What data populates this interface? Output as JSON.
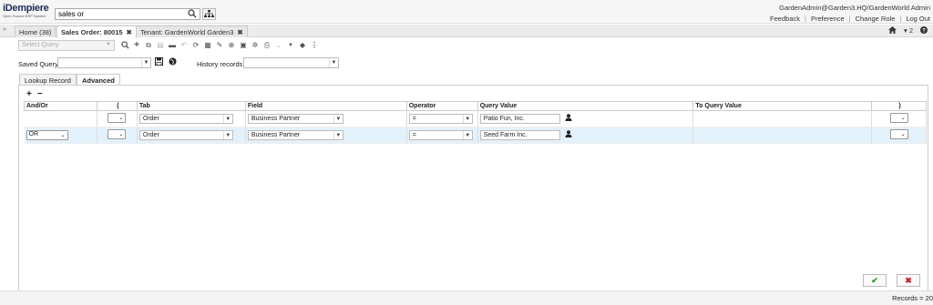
{
  "header": {
    "logo_text": "iDempiere",
    "logo_subtext": "Open Source ERP System",
    "search_value": "sales or",
    "user_info": "GardenAdmin@Garden3.HQ/GardenWorld Admin",
    "links": [
      "Feedback",
      "Preference",
      "Change Role",
      "Log Out"
    ]
  },
  "tabs": [
    {
      "label": "Home (38)",
      "active": false,
      "closable": false
    },
    {
      "label": "Sales Order: 80015",
      "active": true,
      "closable": true
    },
    {
      "label": "Tenant: GardenWorld Garden3",
      "active": false,
      "closable": true
    }
  ],
  "tab_right": {
    "home_icon": "home-icon",
    "count_label": "▾ 2",
    "help_icon": "help-icon"
  },
  "toolbar": {
    "select_query_placeholder": "Select Query",
    "icons": [
      "search-icon",
      "new-icon",
      "copy-icon",
      "delete-icon",
      "minus-icon",
      "undo-icon",
      "refresh-icon",
      "grid-toggle-icon",
      "attachment-icon",
      "zoom-icon",
      "report-icon",
      "settings-icon",
      "print-icon",
      "arrow-icon",
      "chevron-icon",
      "tag-icon",
      "more-icon"
    ]
  },
  "saved_query": {
    "label": "Saved Query",
    "value": ""
  },
  "history": {
    "label": "History records",
    "value": ""
  },
  "inner_tabs": [
    "Lookup Record",
    "Advanced"
  ],
  "grid": {
    "columns": [
      "And/Or",
      "(",
      "Tab",
      "Field",
      "Operator",
      "Query Value",
      "To Query Value",
      ")"
    ],
    "rows": [
      {
        "andor": "",
        "open": "",
        "tab": "Order",
        "field": "Business Partner",
        "operator": "=",
        "value": "Patio Fun, Inc.",
        "to_value": "",
        "close": ""
      },
      {
        "andor": "OR",
        "open": "",
        "tab": "Order",
        "field": "Business Partner",
        "operator": "=",
        "value": "Seed Farm Inc.",
        "to_value": "",
        "close": ""
      }
    ]
  },
  "status": {
    "records": "Records = 20"
  },
  "colors": {
    "accent": "#1b2f5b",
    "ok": "#2a9d2a",
    "cancel": "#d02020",
    "selected_row": "#e3f1fb"
  }
}
